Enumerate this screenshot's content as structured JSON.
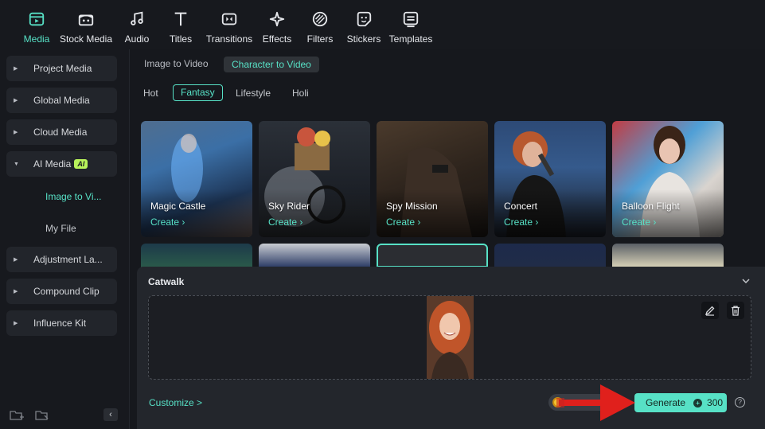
{
  "toolbar": {
    "items": [
      {
        "label": "Media",
        "icon": "media-icon",
        "active": true
      },
      {
        "label": "Stock Media",
        "icon": "stock-media-icon"
      },
      {
        "label": "Audio",
        "icon": "music-note-icon"
      },
      {
        "label": "Titles",
        "icon": "title-t-icon"
      },
      {
        "label": "Transitions",
        "icon": "transitions-icon"
      },
      {
        "label": "Effects",
        "icon": "effects-sparkle-icon"
      },
      {
        "label": "Filters",
        "icon": "filters-icon"
      },
      {
        "label": "Stickers",
        "icon": "sticker-icon"
      },
      {
        "label": "Templates",
        "icon": "templates-icon"
      }
    ]
  },
  "sidebar": {
    "items": [
      {
        "label": "Project Media"
      },
      {
        "label": "Global Media"
      },
      {
        "label": "Cloud Media"
      },
      {
        "label": "AI Media",
        "badge": "AI"
      },
      {
        "label": "Adjustment La..."
      },
      {
        "label": "Compound Clip"
      },
      {
        "label": "Influence Kit"
      }
    ],
    "subitems": [
      {
        "label": "Image to Vi...",
        "active": true
      },
      {
        "label": "My File"
      }
    ],
    "collapse": "‹"
  },
  "main": {
    "mode_tabs": [
      {
        "label": "Image to Video"
      },
      {
        "label": "Character to Video",
        "active": true
      }
    ],
    "categories": [
      {
        "label": "Hot"
      },
      {
        "label": "Fantasy",
        "active": true
      },
      {
        "label": "Lifestyle"
      },
      {
        "label": "Holi"
      }
    ],
    "cards": [
      {
        "title": "Magic Castle",
        "action": "Create"
      },
      {
        "title": "Sky Rider",
        "action": "Create"
      },
      {
        "title": "Spy Mission",
        "action": "Create"
      },
      {
        "title": "Concert",
        "action": "Create"
      },
      {
        "title": "Balloon Flight",
        "action": "Create"
      }
    ]
  },
  "panel": {
    "title": "Catwalk",
    "customize": "Customize >",
    "generate_label": "Generate",
    "credits": "300",
    "help": "?"
  },
  "colors": {
    "accent": "#57e1c6",
    "background": "#16181d",
    "panel": "#23262c",
    "annotation_arrow": "#e0201c"
  }
}
